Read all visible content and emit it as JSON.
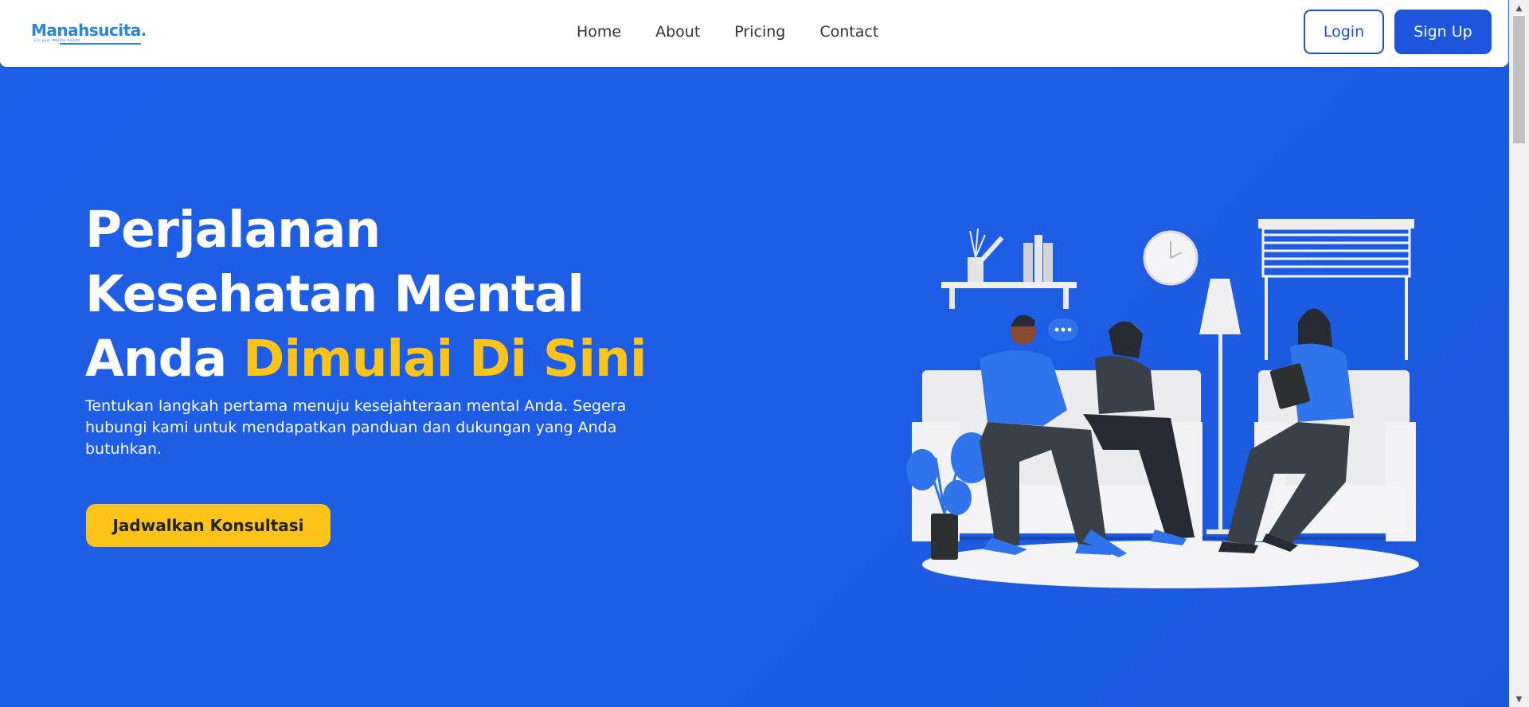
{
  "brand": {
    "name": "Manahsucita.",
    "tagline": "For your Mental health",
    "color": "#2b86d6"
  },
  "nav": {
    "items": [
      {
        "label": "Home"
      },
      {
        "label": "About"
      },
      {
        "label": "Pricing"
      },
      {
        "label": "Contact"
      }
    ]
  },
  "auth": {
    "login_label": "Login",
    "signup_label": "Sign Up"
  },
  "hero": {
    "title_line1": "Perjalanan",
    "title_line2": "Kesehatan Mental",
    "title_line3_prefix": "Anda",
    "title_highlight": "Dimulai Di Sini",
    "description": "Tentukan langkah pertama menuju kesejahteraan mental Anda. Segera hubungi kami untuk mendapatkan panduan dan dukungan yang Anda butuhkan.",
    "cta_label": "Jadwalkan Konsultasi"
  },
  "colors": {
    "hero_background": "#1e5fe8",
    "accent": "#fcc419",
    "primary_button": "#1d56dd",
    "illustration_blue": "#2f74ea"
  },
  "scrollbar": {
    "up_icon": "triangle-up-icon",
    "down_icon": "triangle-down-icon"
  }
}
